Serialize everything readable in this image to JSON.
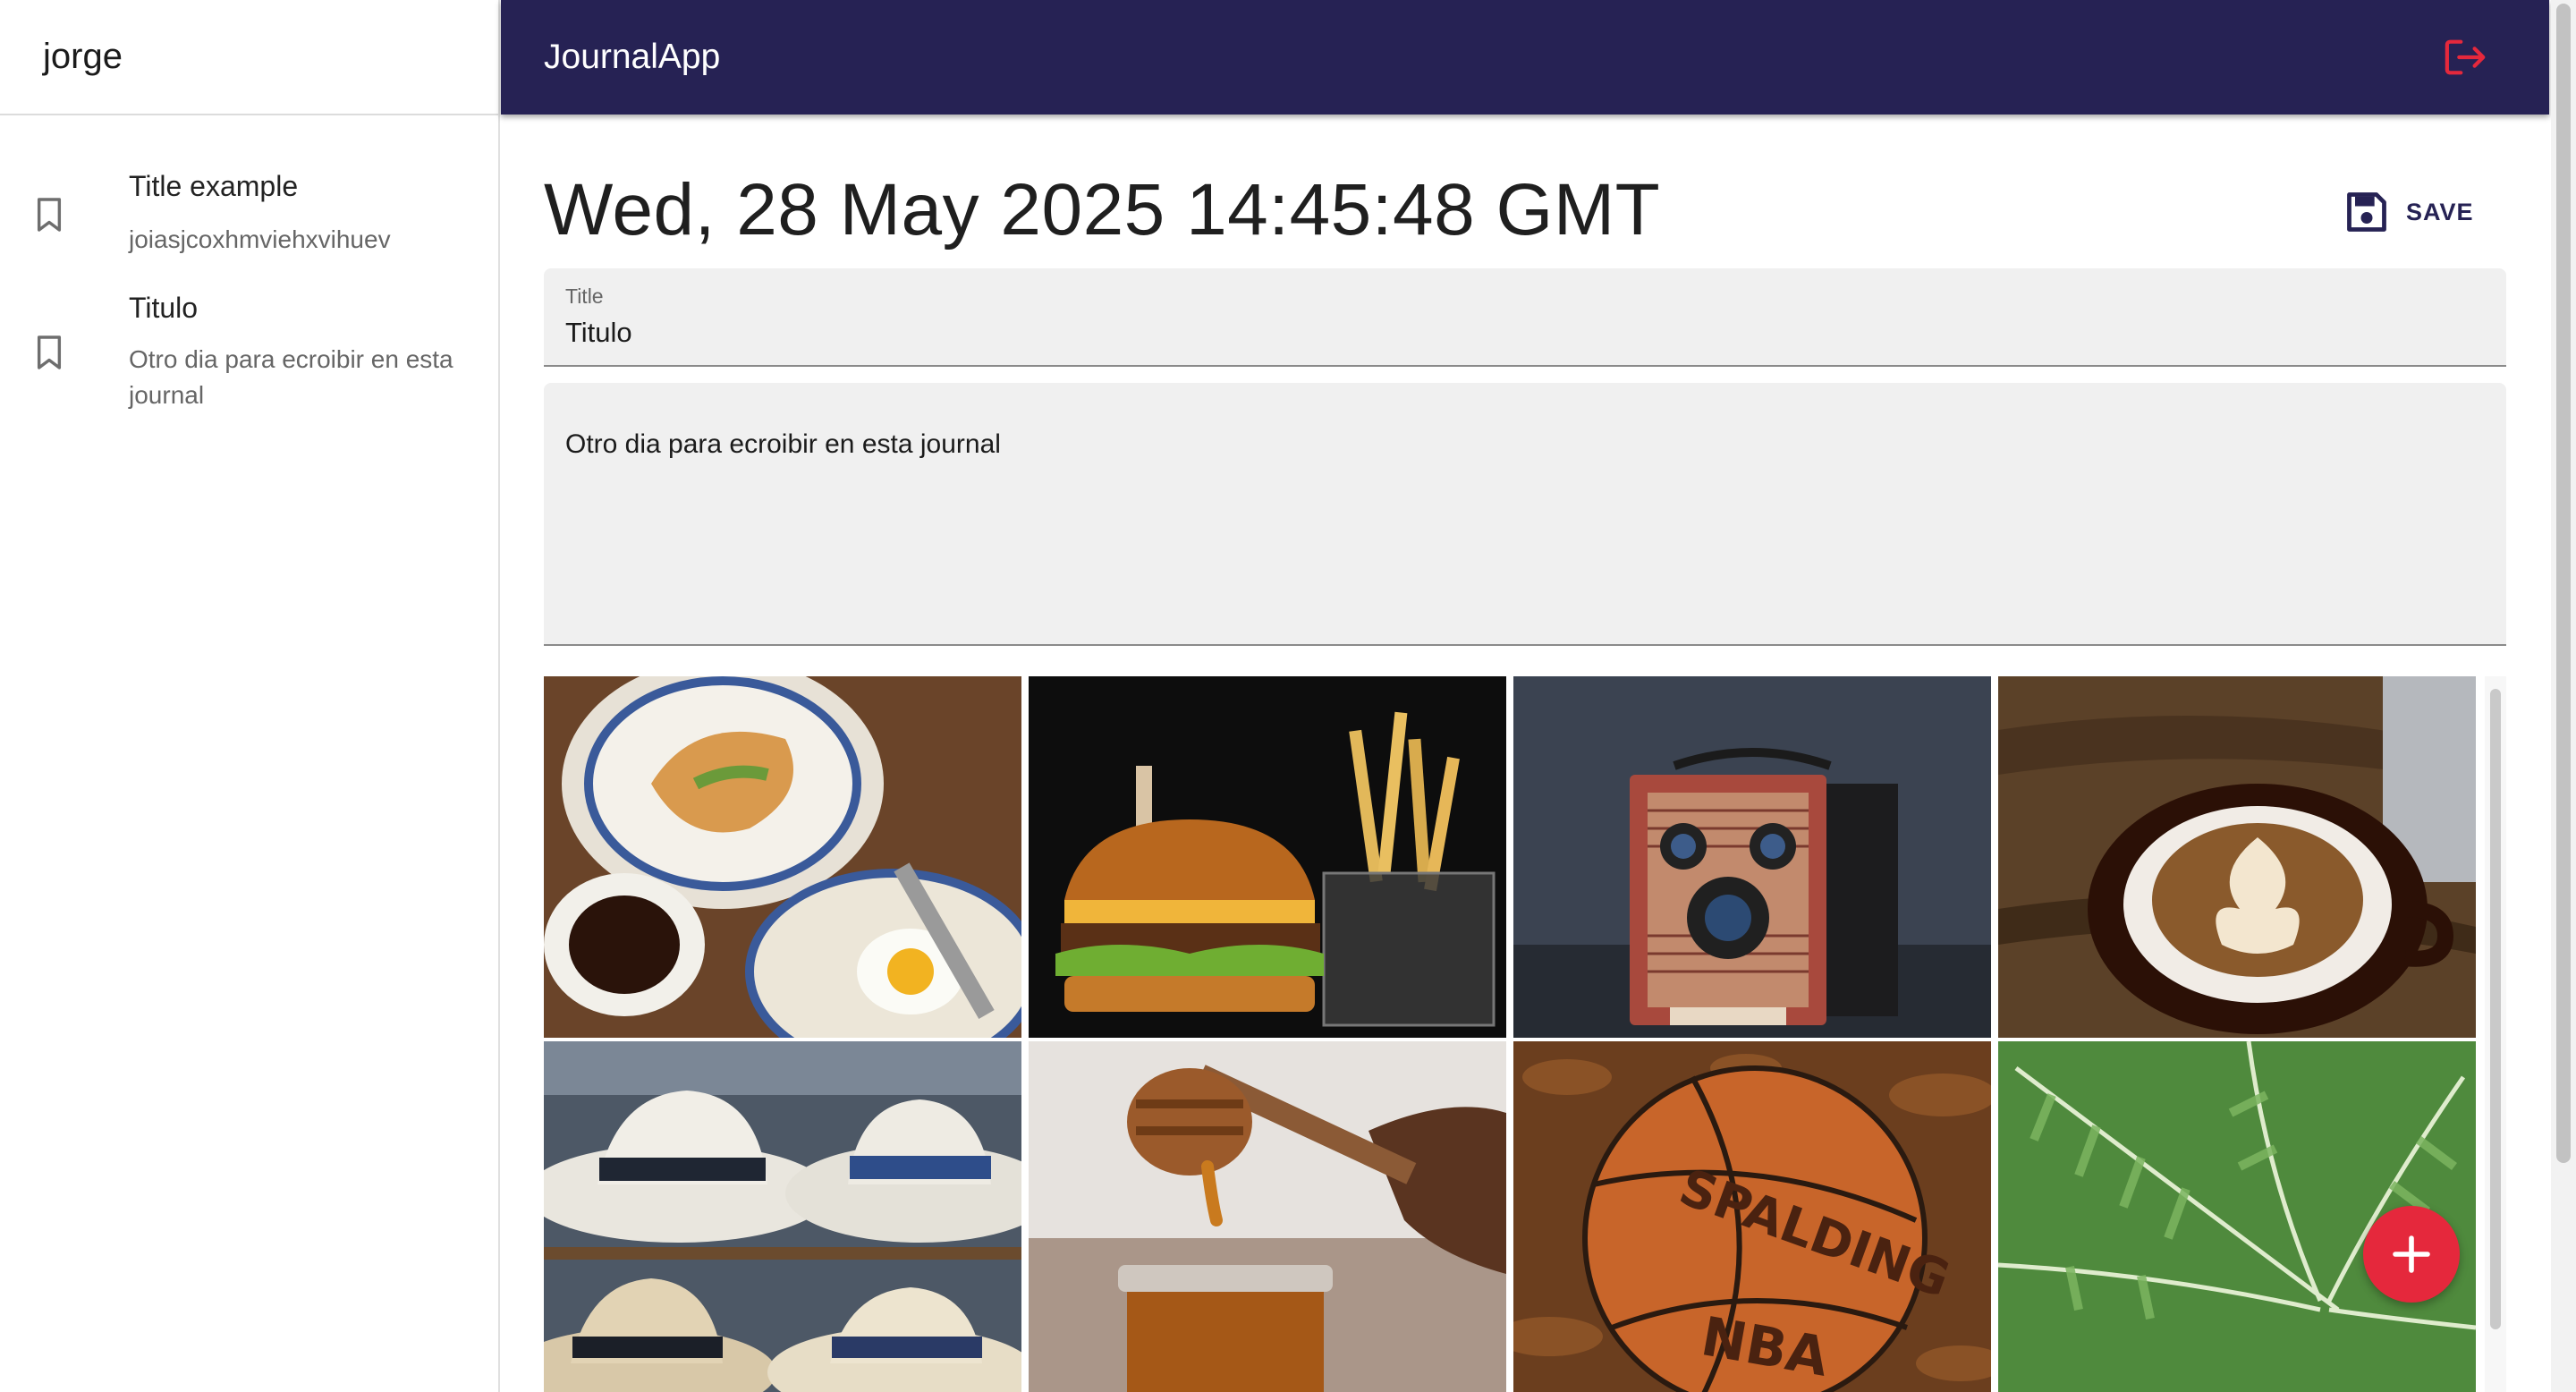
{
  "sidebar": {
    "username": "jorge",
    "entries": [
      {
        "title": "Title example",
        "body": "joiasjcoxhmviehxvihuev",
        "icon": "bookmark-icon"
      },
      {
        "title": "Titulo",
        "body": "Otro dia para ecroibir en esta journal",
        "icon": "bookmark-icon"
      }
    ]
  },
  "appbar": {
    "title": "JournalApp",
    "logout_icon": "logout-icon",
    "background": "#262254",
    "logout_color": "#e5283c"
  },
  "note": {
    "date": "Wed, 28 May 2025 14:45:48 GMT",
    "save_label": "SAVE",
    "save_icon": "save-icon",
    "title_label": "Title",
    "title_value": "Titulo",
    "body_value": "Otro dia para ecroibir en esta journal"
  },
  "gallery": {
    "images": [
      "breakfast-photo",
      "burger-fries-photo",
      "vintage-camera-photo",
      "latte-art-photo",
      "straw-hats-photo",
      "honey-dipper-photo",
      "basketball-photo",
      "fern-leaves-photo"
    ]
  },
  "fab": {
    "icon": "add-icon",
    "color": "#e5283c"
  }
}
